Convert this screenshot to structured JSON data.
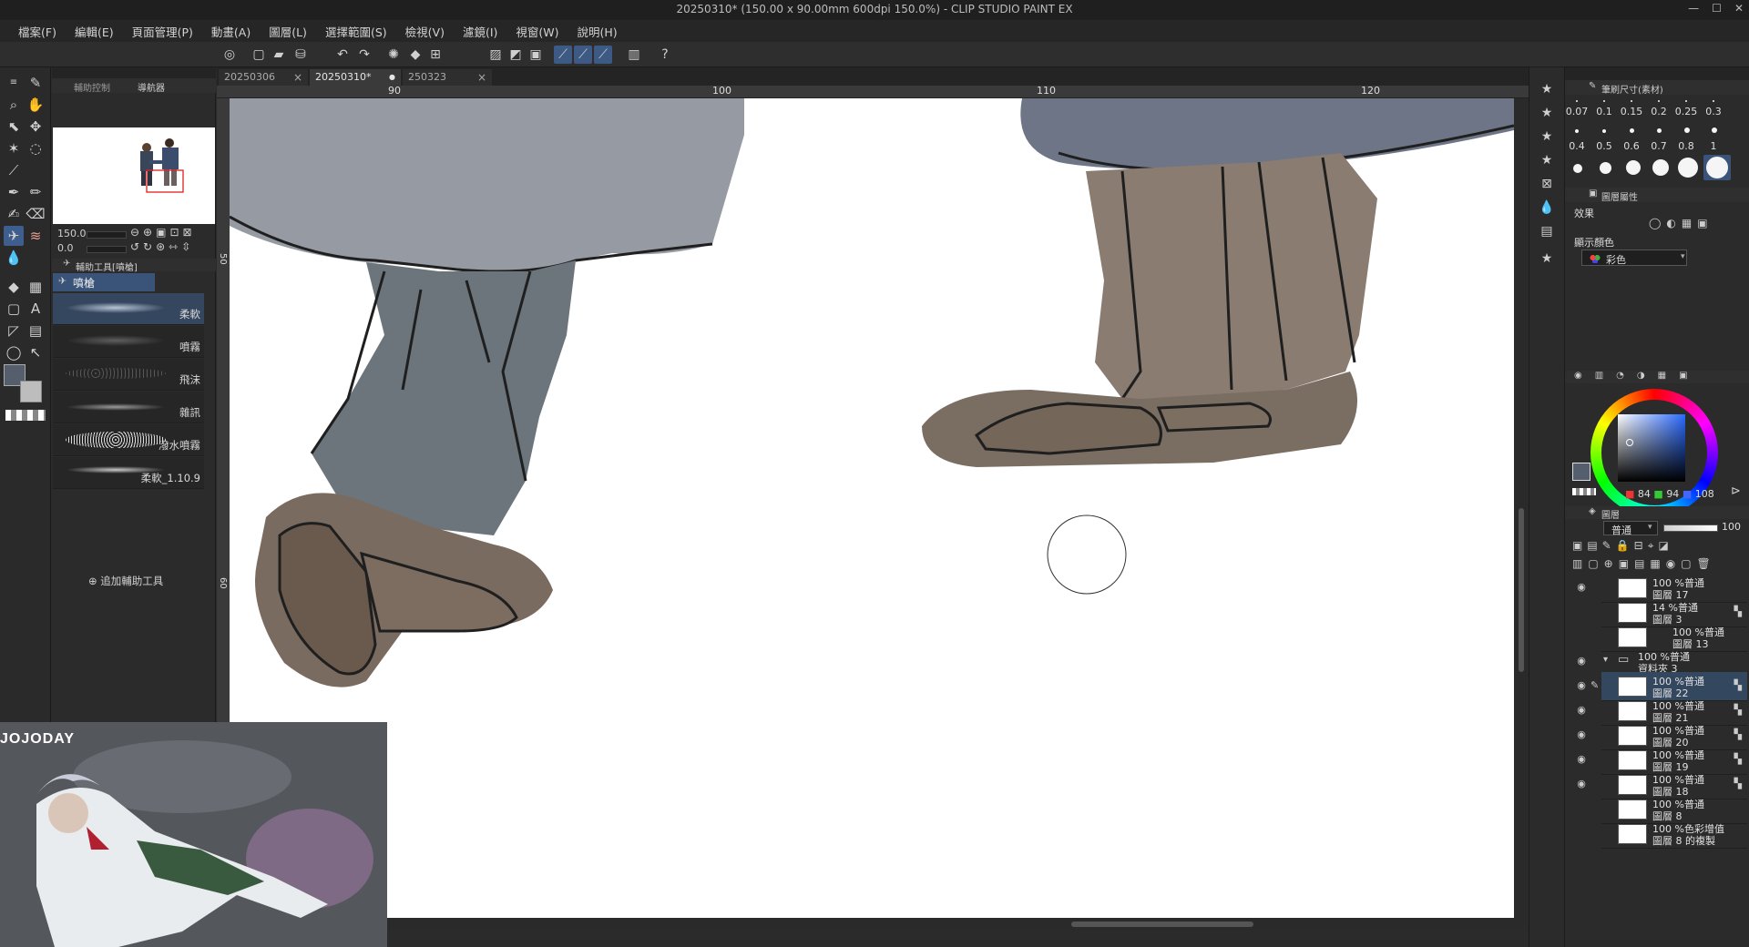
{
  "window": {
    "title": "20250310* (150.00 x 90.00mm 600dpi 150.0%)  - CLIP STUDIO PAINT EX",
    "min": "—",
    "max": "☐",
    "close": "✕"
  },
  "menu": [
    "檔案(F)",
    "編輯(E)",
    "頁面管理(P)",
    "動畫(A)",
    "圖層(L)",
    "選擇範圍(S)",
    "檢視(V)",
    "濾鏡(I)",
    "視窗(W)",
    "說明(H)"
  ],
  "left_panel": {
    "tab1": "輔助控制",
    "tab2": "導航器",
    "zoom_value": "150.0",
    "rotate_value": "0.0",
    "subtool_header": "輔助工具[噴槍]",
    "subtool_group": "噴槍",
    "brushes": [
      "柔軟",
      "噴霧",
      "飛沫",
      "雜訊",
      "潑水噴霧",
      "柔軟_1.10.9"
    ],
    "add_subtool": "追加輔助工具"
  },
  "doc_tabs": [
    {
      "label": "20250306",
      "close": "×"
    },
    {
      "label": "20250310*",
      "close": "●"
    },
    {
      "label": "250323",
      "close": "×"
    }
  ],
  "ruler": {
    "top": [
      "90",
      "100",
      "110",
      "120"
    ],
    "left": [
      "50",
      "60"
    ]
  },
  "brush_size": {
    "header": "筆刷尺寸(素材)",
    "sizes": [
      "0.07",
      "0.1",
      "0.15",
      "0.2",
      "0.25",
      "0.3",
      "0.4",
      "0.5",
      "0.6",
      "0.7",
      "0.8",
      "1"
    ]
  },
  "layer_property": {
    "header": "圖層屬性",
    "effect_label": "效果",
    "display_color_label": "顯示顏色",
    "display_color_value": "彩色"
  },
  "color": {
    "r": "84",
    "g": "94",
    "b": "108",
    "main": "#545e6c",
    "sub": "#ffffff"
  },
  "layers_panel": {
    "tab": "圖層",
    "blend_mode": "普通",
    "opacity": "100",
    "layers": [
      {
        "line1": "100 %普通",
        "line2": "圖層 17"
      },
      {
        "line1": "14 %普通",
        "line2": "圖層 3"
      },
      {
        "line1": "100 %普通",
        "line2": "圖層 13"
      },
      {
        "line1": "100 %普通",
        "line2": "資料夾 3"
      },
      {
        "line1": "100 %普通",
        "line2": "圖層 22"
      },
      {
        "line1": "100 %普通",
        "line2": "圖層 21"
      },
      {
        "line1": "100 %普通",
        "line2": "圖層 20"
      },
      {
        "line1": "100 %普通",
        "line2": "圖層 19"
      },
      {
        "line1": "100 %普通",
        "line2": "圖層 18"
      },
      {
        "line1": "100 %普通",
        "line2": "圖層 8"
      },
      {
        "line1": "100 %色彩增值",
        "line2": "圖層 8 的複製"
      }
    ]
  },
  "overlay": {
    "brand": "JOJODAY"
  }
}
